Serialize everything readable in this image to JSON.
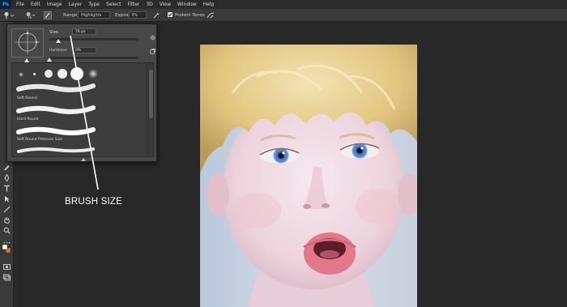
{
  "app": {
    "logo": "Ps"
  },
  "menu": [
    "File",
    "Edit",
    "Image",
    "Layer",
    "Type",
    "Select",
    "Filter",
    "3D",
    "View",
    "Window",
    "Help"
  ],
  "options": {
    "brush_size": "76",
    "range_label": "Range:",
    "range_value": "Highlights",
    "exposure_label": "Exposure:",
    "exposure_value": "3%",
    "protect_tones_label": "Protect Tones",
    "protect_tones_checked": true
  },
  "brush_panel": {
    "size_label": "Size:",
    "size_value": "76 px",
    "size_fraction": 0.1,
    "hardness_label": "Hardness:",
    "hardness_value": "0%",
    "hardness_fraction": 0.0,
    "presets": [
      "Soft Round",
      "Hard Round",
      "Soft Round Pressure Size"
    ]
  },
  "annotation": {
    "text": "BRUSH SIZE"
  },
  "colors": {
    "workspace": "#282828",
    "panel": "#474747",
    "accent": "#31a8ff"
  },
  "icons": {
    "tool_option": "dodge-tool-icon",
    "brush_panel": "brush-panel-icon",
    "airbrush": "airbrush-icon",
    "pressure": "pressure-icon",
    "gear": "gear-icon",
    "new_preset": "new-preset-icon"
  }
}
